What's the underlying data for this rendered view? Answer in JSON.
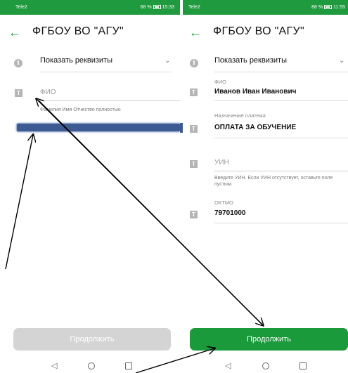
{
  "left": {
    "status": {
      "carrier": "Tele2",
      "battery": "68 %",
      "time": "15:33"
    },
    "title": "ФГБОУ ВО \"АГУ\"",
    "requisites_label": "Показать реквизиты",
    "fio_placeholder": "ФИО",
    "fio_hint": "Фамилия Имя Отчество полностью",
    "continue_label": "Продолжить"
  },
  "right": {
    "status": {
      "carrier": "Tele2",
      "battery": "88 %",
      "time": "11:55"
    },
    "title": "ФГБОУ ВО \"АГУ\"",
    "requisites_label": "Показать реквизиты",
    "fio_caption": "ФИО",
    "fio_value": "Иванов Иван Иванович",
    "purpose_caption": "Назначение платежа",
    "purpose_value": "ОПЛАТА ЗА ОБУЧЕНИЕ",
    "uin_placeholder": "УИН",
    "uin_hint": "Введите УИН. Если УИН отсутствует, оставьте поле пустым.",
    "oktmo_caption": "ОКТМО",
    "oktmo_value": "79701000",
    "continue_label": "Продолжить"
  },
  "colors": {
    "accent_green": "#1a9a3a",
    "disabled_button": "#d4d4d4",
    "redaction_blue": "#3d5a93"
  },
  "icons": [
    "back-arrow-icon",
    "info-icon",
    "text-field-icon",
    "chevron-down-icon",
    "nav-back-icon",
    "nav-home-icon",
    "nav-recent-icon"
  ]
}
